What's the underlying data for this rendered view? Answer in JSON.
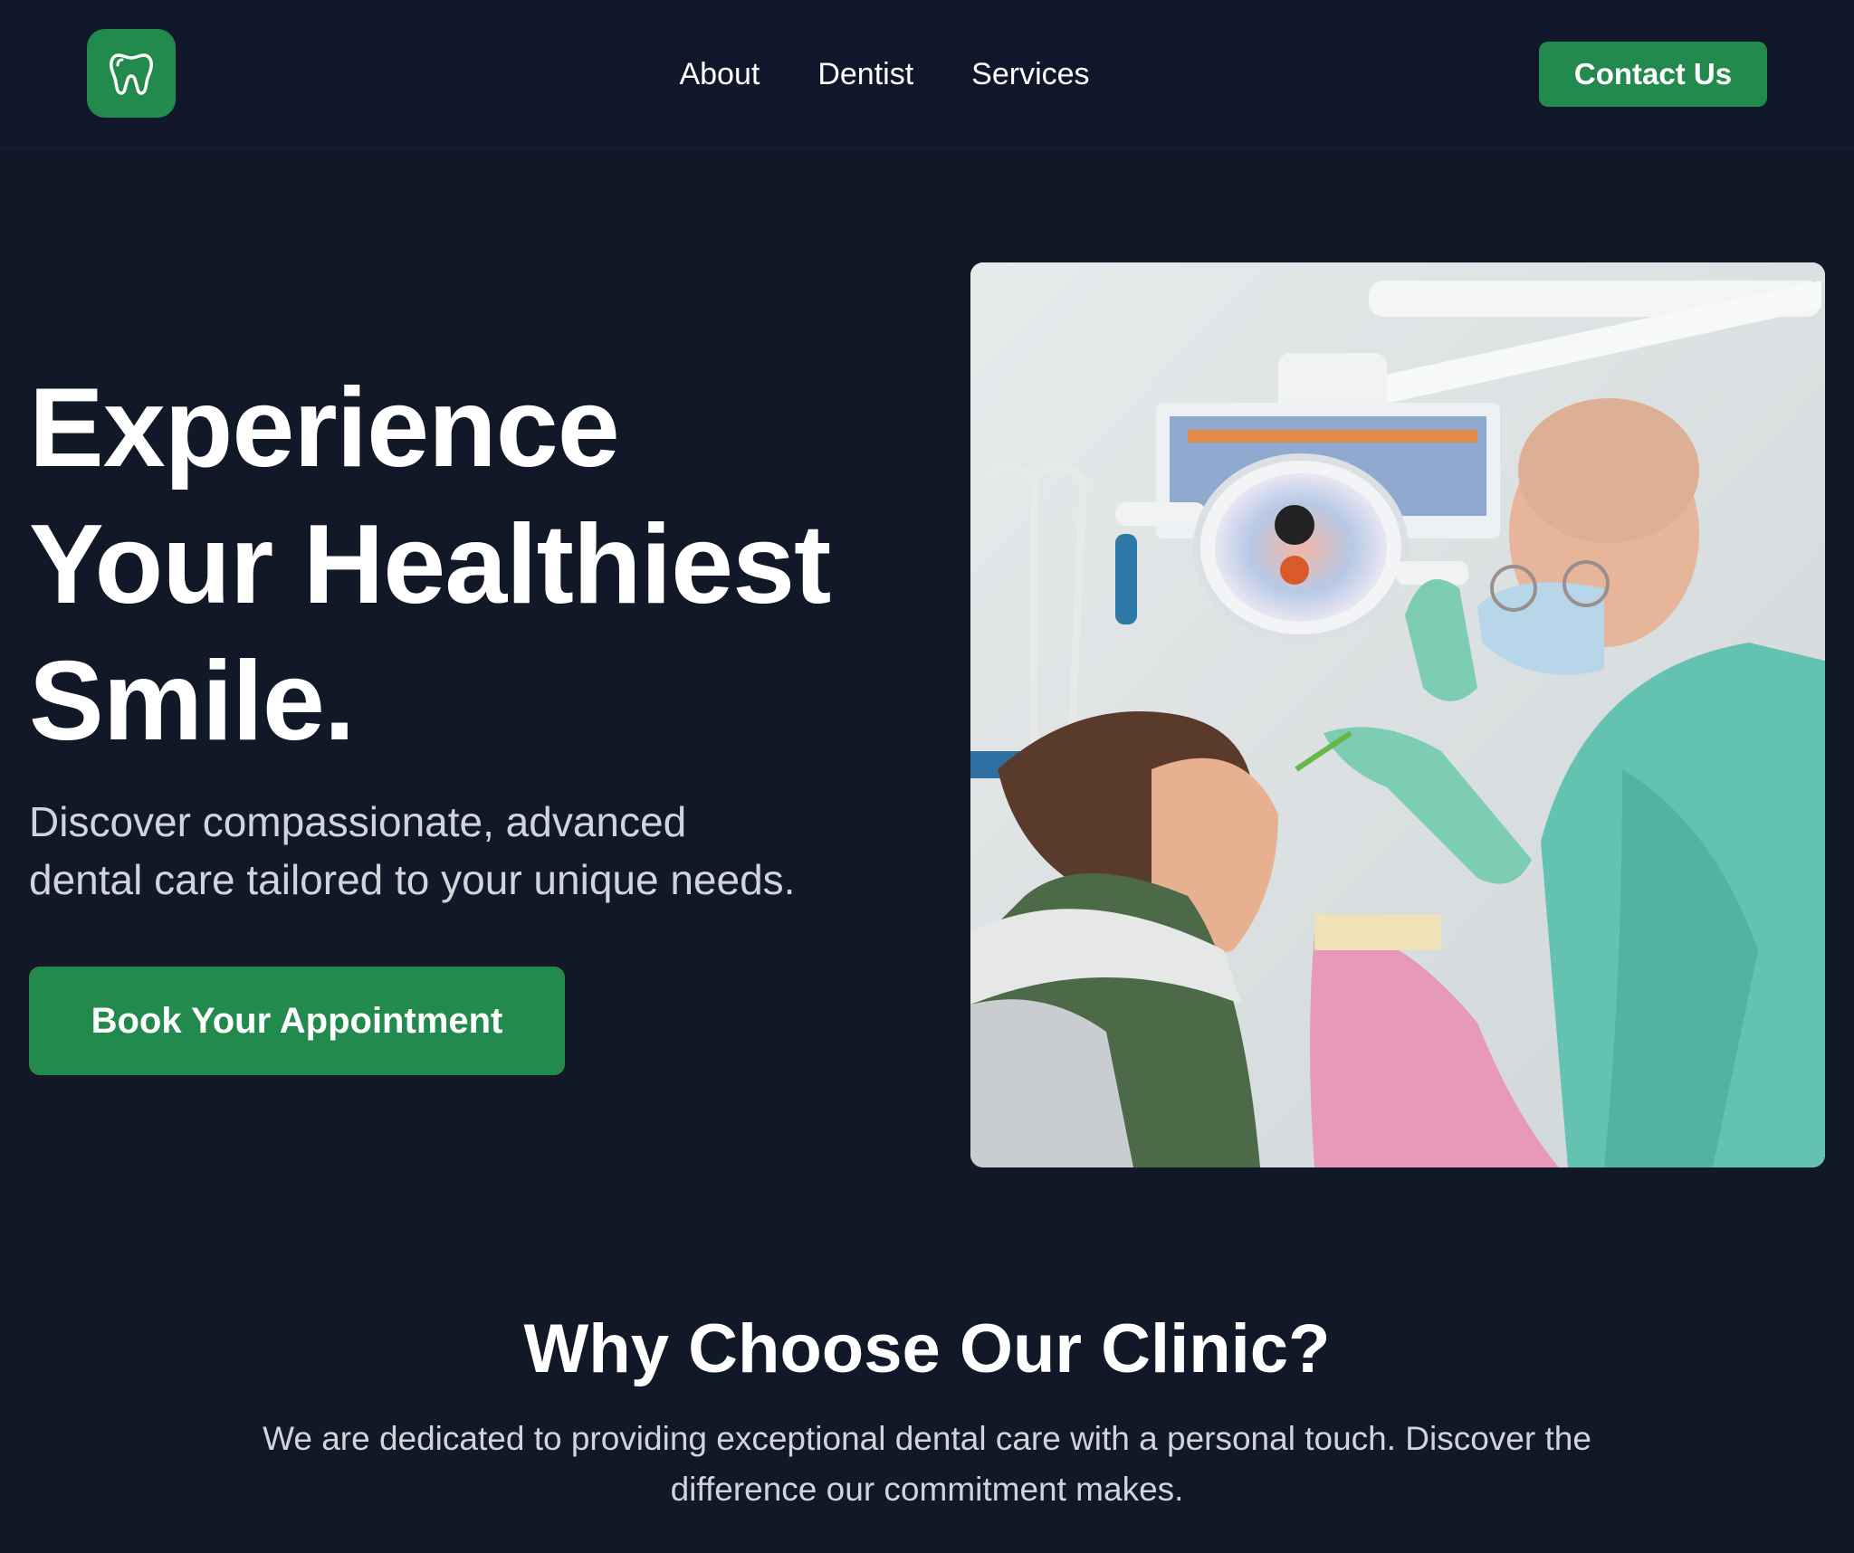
{
  "header": {
    "logo_icon": "tooth-icon",
    "nav": [
      {
        "label": "About"
      },
      {
        "label": "Dentist"
      },
      {
        "label": "Services"
      }
    ],
    "contact_label": "Contact Us"
  },
  "hero": {
    "title_lines": [
      "Experience",
      "Your Healthiest",
      "Smile."
    ],
    "subtitle_lines": [
      "Discover compassionate, advanced",
      "dental care tailored to your unique needs."
    ],
    "cta_label": "Book Your Appointment",
    "image_icon": "dentist-photo"
  },
  "why": {
    "title": "Why Choose Our Clinic?",
    "text": "We are dedicated to providing exceptional dental care with a personal touch. Discover the difference our commitment makes."
  },
  "colors": {
    "background": "#111827",
    "accent": "#238a4d",
    "muted_text": "#d1d5db"
  }
}
